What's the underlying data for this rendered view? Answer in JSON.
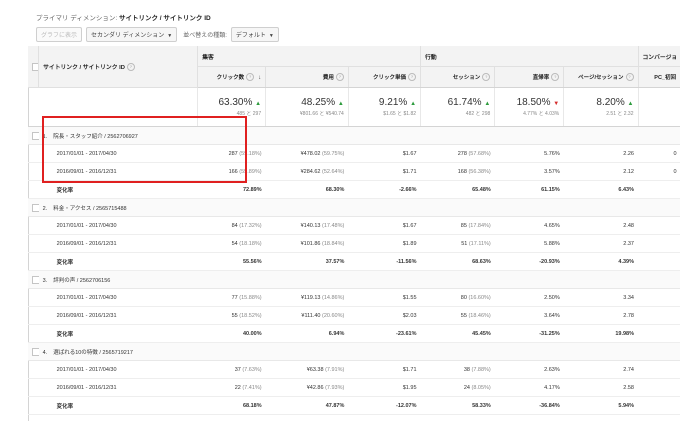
{
  "primary_dimension": {
    "label": "プライマリ ディメンション:",
    "value": "サイトリンク / サイトリンク ID"
  },
  "toolbar": {
    "chart_button": "グラフに表示",
    "secondary_dimension": "セカンダリ ディメンション",
    "sort_label": "並べ替えの種類:",
    "sort_value": "デフォルト"
  },
  "headers": {
    "dimension": "サイトリンク / サイトリンク ID",
    "group_acquisition": "集客",
    "group_behavior": "行動",
    "group_conversion": "コンバージョ",
    "metrics": [
      "クリック数",
      "費用",
      "クリック単価",
      "セッション",
      "直帰率",
      "ページ/セッション",
      "PC_初回"
    ]
  },
  "totals": [
    {
      "value": "63.30%",
      "dir": "up",
      "detail": "485 と 297"
    },
    {
      "value": "48.25%",
      "dir": "up",
      "detail": "¥801.66 と ¥540.74"
    },
    {
      "value": "9.21%",
      "dir": "up",
      "detail": "$1.65 と $1.82"
    },
    {
      "value": "61.74%",
      "dir": "up",
      "detail": "482 と 298"
    },
    {
      "value": "18.50%",
      "dir": "down",
      "detail": "4.77% と 4.03%"
    },
    {
      "value": "8.20%",
      "dir": "up",
      "detail": "2.51 と 2.32"
    },
    {
      "value": "",
      "dir": "",
      "detail": ""
    }
  ],
  "entries": [
    {
      "num": "1.",
      "name": "院長・スタッフ紹介 / 2562706927",
      "rows": [
        {
          "label": "2017/01/01 - 2017/04/30",
          "cells": [
            [
              "287",
              "(59.18%)"
            ],
            [
              "¥478.02",
              "(59.75%)"
            ],
            [
              "$1.67",
              ""
            ],
            [
              "278",
              "(57.68%)"
            ],
            [
              "5.76%",
              ""
            ],
            [
              "2.26",
              ""
            ],
            [
              "0",
              ""
            ]
          ]
        },
        {
          "label": "2016/09/01 - 2016/12/31",
          "cells": [
            [
              "166",
              "(55.89%)"
            ],
            [
              "¥284.62",
              "(52.64%)"
            ],
            [
              "$1.71",
              ""
            ],
            [
              "168",
              "(56.38%)"
            ],
            [
              "3.57%",
              ""
            ],
            [
              "2.12",
              ""
            ],
            [
              "0",
              ""
            ]
          ]
        }
      ],
      "change": {
        "label": "変化率",
        "cells": [
          "72.89%",
          "68.30%",
          "-2.66%",
          "65.48%",
          "61.15%",
          "6.43%",
          ""
        ]
      }
    },
    {
      "num": "2.",
      "name": "料金・アクセス / 2565715488",
      "rows": [
        {
          "label": "2017/01/01 - 2017/04/30",
          "cells": [
            [
              "84",
              "(17.32%)"
            ],
            [
              "¥140.13",
              "(17.48%)"
            ],
            [
              "$1.67",
              ""
            ],
            [
              "85",
              "(17.84%)"
            ],
            [
              "4.65%",
              ""
            ],
            [
              "2.48",
              ""
            ],
            [
              "",
              ""
            ]
          ]
        },
        {
          "label": "2016/09/01 - 2016/12/31",
          "cells": [
            [
              "54",
              "(18.18%)"
            ],
            [
              "¥101.86",
              "(18.84%)"
            ],
            [
              "$1.89",
              ""
            ],
            [
              "51",
              "(17.11%)"
            ],
            [
              "5.88%",
              ""
            ],
            [
              "2.37",
              ""
            ],
            [
              "",
              ""
            ]
          ]
        }
      ],
      "change": {
        "label": "変化率",
        "cells": [
          "55.56%",
          "37.57%",
          "-11.56%",
          "68.63%",
          "-20.93%",
          "4.39%",
          ""
        ]
      }
    },
    {
      "num": "3.",
      "name": "評判の声 / 2562706156",
      "rows": [
        {
          "label": "2017/01/01 - 2017/04/30",
          "cells": [
            [
              "77",
              "(15.88%)"
            ],
            [
              "¥119.13",
              "(14.86%)"
            ],
            [
              "$1.55",
              ""
            ],
            [
              "80",
              "(16.60%)"
            ],
            [
              "2.50%",
              ""
            ],
            [
              "3.34",
              ""
            ],
            [
              "",
              ""
            ]
          ]
        },
        {
          "label": "2016/09/01 - 2016/12/31",
          "cells": [
            [
              "55",
              "(18.52%)"
            ],
            [
              "¥111.40",
              "(20.60%)"
            ],
            [
              "$2.03",
              ""
            ],
            [
              "55",
              "(18.46%)"
            ],
            [
              "3.64%",
              ""
            ],
            [
              "2.78",
              ""
            ],
            [
              "",
              ""
            ]
          ]
        }
      ],
      "change": {
        "label": "変化率",
        "cells": [
          "40.00%",
          "6.94%",
          "-23.61%",
          "45.45%",
          "-31.25%",
          "19.98%",
          ""
        ]
      }
    },
    {
      "num": "4.",
      "name": "選ばれる10の特徴 / 2565719217",
      "rows": [
        {
          "label": "2017/01/01 - 2017/04/30",
          "cells": [
            [
              "37",
              "(7.63%)"
            ],
            [
              "¥63.38",
              "(7.91%)"
            ],
            [
              "$1.71",
              ""
            ],
            [
              "38",
              "(7.88%)"
            ],
            [
              "2.63%",
              ""
            ],
            [
              "2.74",
              ""
            ],
            [
              "",
              ""
            ]
          ]
        },
        {
          "label": "2016/09/01 - 2016/12/31",
          "cells": [
            [
              "22",
              "(7.41%)"
            ],
            [
              "¥42.86",
              "(7.93%)"
            ],
            [
              "$1.95",
              ""
            ],
            [
              "24",
              "(8.05%)"
            ],
            [
              "4.17%",
              ""
            ],
            [
              "2.58",
              ""
            ],
            [
              "",
              ""
            ]
          ]
        }
      ],
      "change": {
        "label": "変化率",
        "cells": [
          "68.18%",
          "47.87%",
          "-12.07%",
          "58.33%",
          "-36.84%",
          "5.94%",
          ""
        ]
      }
    }
  ],
  "colors": {
    "highlight": "#e02020",
    "up": "#2e9c3e",
    "down": "#d52d2d"
  },
  "icons": {
    "sort": "sort-down-arrow-icon",
    "info": "info-circle-icon",
    "up": "triangle-up-icon",
    "down": "triangle-down-icon"
  }
}
